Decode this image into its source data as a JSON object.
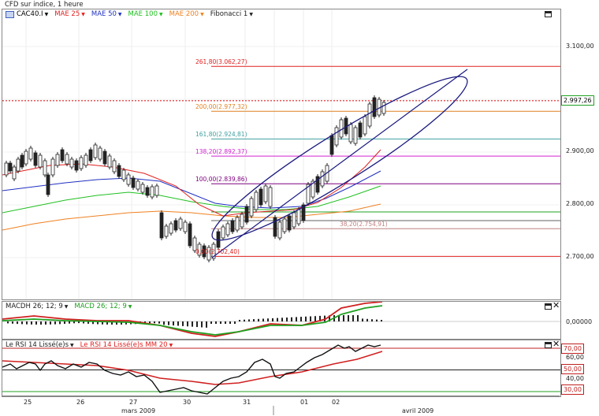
{
  "page_title": "CFD sur indice, 1 heure",
  "main": {
    "legend": {
      "symbol": "CAC40.I",
      "mae25": "MAE 25",
      "mae50": "MAE 50",
      "mae100": "MAE 100",
      "mae200": "MAE 200",
      "fibonacci": "Fibonacci 1"
    },
    "colors": {
      "mae25": "#e02020",
      "mae50": "#2030c0",
      "mae100": "#20c020",
      "mae200": "#f08020",
      "fib_red": "#e02020",
      "fib_orange": "#e08020",
      "fib_teal": "#40a0a0",
      "fib_magenta": "#d020d0",
      "fib_purple": "#800080",
      "fib_pink": "#c08080",
      "price_line": "#e02020"
    },
    "y_labels": [
      "3.100,00",
      "3.000,00",
      "2.900,00",
      "2.800,00",
      "2.700,00"
    ],
    "current_price": "2.997,26",
    "fib_levels": [
      {
        "label": "261,80(3.062,27)",
        "value": 3062.27
      },
      {
        "label": "200,00(2.977,32)",
        "value": 2977.32
      },
      {
        "label": "161,80(2.924,81)",
        "value": 2924.81
      },
      {
        "label": "138,20(2.892,37)",
        "value": 2892.37
      },
      {
        "label": "100,00(2.839,86)",
        "value": 2839.86
      },
      {
        "label": "38,20(2.754,91)",
        "value": 2754.91
      },
      {
        "label": "0,00(2.702,40)",
        "value": 2702.4
      }
    ]
  },
  "macd": {
    "legend": {
      "macdh": "MACDH 26; 12; 9",
      "macd": "MACD 26; 12; 9"
    },
    "y_labels": [
      "0,00000"
    ]
  },
  "rsi": {
    "legend": {
      "rsi": "Le RSI 14 Lissé(e)s",
      "rsi_mm": "Le RSI 14 Lissé(e)s MM 20"
    },
    "y_labels": [
      "70,00",
      "60,00",
      "50,00",
      "40,00",
      "30,00"
    ]
  },
  "x_axis": {
    "days": [
      "25",
      "26",
      "27",
      "30",
      "31",
      "01",
      "02"
    ],
    "months": [
      "mars 2009",
      "avril 2009"
    ]
  }
}
